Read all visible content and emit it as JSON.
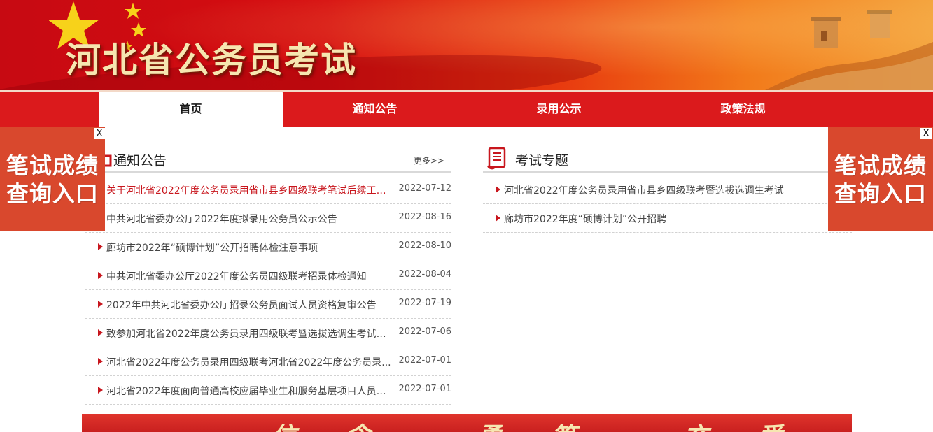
{
  "header": {
    "site_title": "河北省公务员考试"
  },
  "nav": {
    "items": [
      {
        "label": "首页",
        "active": true
      },
      {
        "label": "通知公告",
        "active": false
      },
      {
        "label": "录用公示",
        "active": false
      },
      {
        "label": "政策法规",
        "active": false
      }
    ]
  },
  "notices": {
    "title": "通知公告",
    "more_label": "更多>>",
    "items": [
      {
        "text": "关于河北省2022年度公务员录用省市县乡四级联考笔试后续工作...",
        "date": "2022-07-12"
      },
      {
        "text": "中共河北省委办公厅2022年度拟录用公务员公示公告",
        "date": "2022-08-16"
      },
      {
        "text": "廊坊市2022年“硕博计划”公开招聘体检注意事项",
        "date": "2022-08-10"
      },
      {
        "text": "中共河北省委办公厅2022年度公务员四级联考招录体检通知",
        "date": "2022-08-04"
      },
      {
        "text": "2022年中共河北省委办公厅招录公务员面试人员资格复审公告",
        "date": "2022-07-19"
      },
      {
        "text": "致参加河北省2022年度公务员录用四级联考暨选拔选调生考试考...",
        "date": "2022-07-06"
      },
      {
        "text": "河北省2022年度公务员录用四级联考河北省2022年度公务员录...",
        "date": "2022-07-01"
      },
      {
        "text": "河北省2022年度面向普通高校应届毕业生和服务基层项目人员选...",
        "date": "2022-07-01"
      }
    ]
  },
  "topics": {
    "title": "考试专题",
    "items": [
      {
        "text": "河北省2022年度公务员录用省市县乡四级联考暨选拔选调生考试"
      },
      {
        "text": "廊坊市2022年度“硕博计划”公开招聘"
      }
    ]
  },
  "side_ads": {
    "line1": "笔试成绩",
    "line2": "查询入口",
    "close_label": "X"
  },
  "bottom_banner": {
    "slogan": "信念 勇笃 充爱 担依"
  },
  "colors": {
    "brand_red": "#db1a1c",
    "accent_red": "#c8161d",
    "ad_orange": "#d9482d",
    "title_gold": "#f6e6b0"
  },
  "icons": {
    "notices": "square-bullet-icon",
    "topics": "scroll-document-icon",
    "list": "triangle-arrow-icon"
  }
}
